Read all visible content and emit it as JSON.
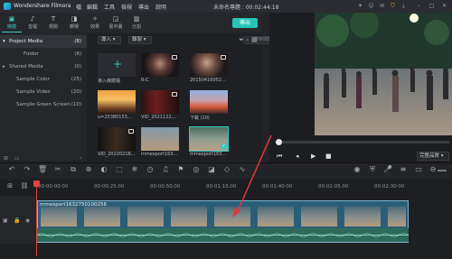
{
  "app": {
    "name": "Wondershare Filmora",
    "project_title": "未命名專題 : 00:02:44:18"
  },
  "menu": [
    "檔",
    "編輯",
    "工具",
    "檢視",
    "導出",
    "說明"
  ],
  "tabs": [
    {
      "label": "媒體",
      "icon": "folder-icon",
      "active": true
    },
    {
      "label": "音檔",
      "icon": "music-note-icon",
      "active": false
    },
    {
      "label": "標題",
      "icon": "text-icon",
      "active": false
    },
    {
      "label": "轉場",
      "icon": "transition-icon",
      "active": false
    },
    {
      "label": "效果",
      "icon": "effects-icon",
      "active": false
    },
    {
      "label": "書中畫",
      "icon": "pip-icon",
      "active": false
    },
    {
      "label": "分割",
      "icon": "split-icon",
      "active": false
    }
  ],
  "export_label": "導出",
  "sidebar": {
    "items": [
      {
        "label": "Project Media",
        "count": "(8)",
        "selected": true,
        "expander": "▾"
      },
      {
        "label": "Folder",
        "count": "(8)",
        "selected": false,
        "expander": ""
      },
      {
        "label": "Shared Media",
        "count": "(0)",
        "selected": false,
        "expander": "▸"
      },
      {
        "label": "Sample Color",
        "count": "(25)",
        "selected": false,
        "expander": ""
      },
      {
        "label": "Sample Video",
        "count": "(20)",
        "selected": false,
        "expander": ""
      },
      {
        "label": "Sample Green Screen",
        "count": "(10)",
        "selected": false,
        "expander": ""
      }
    ]
  },
  "library": {
    "import_label": "導入",
    "record_label": "錄製",
    "search_placeholder": "搜索媒體",
    "tiles": [
      {
        "label": "導入媒體檔",
        "kind": "import"
      },
      {
        "label": "R-C",
        "kind": "photo"
      },
      {
        "label": "20150416052...",
        "kind": "photo"
      },
      {
        "label": "u=25380153...",
        "kind": "sunset"
      },
      {
        "label": "VID_2021122...",
        "kind": "video"
      },
      {
        "label": "下載 (10)",
        "kind": "city"
      },
      {
        "label": "VID_20220218...",
        "kind": "video"
      },
      {
        "label": "mmexport163...",
        "kind": "dance"
      },
      {
        "label": "mmexport163...",
        "kind": "dance-selected"
      }
    ]
  },
  "preview": {
    "quality": "完整品質"
  },
  "timeline": {
    "ticks": [
      "00:00:00:00",
      "00:00:25:00",
      "00:00:50:00",
      "00:01:15:00",
      "00:01:40:00",
      "00:02:05:00",
      "00:02:30:00"
    ],
    "clip_label": "mmexport1632750100256"
  },
  "colors": {
    "accent": "#27c3b7",
    "playhead": "#e04343",
    "clip": "#2a5e76"
  }
}
